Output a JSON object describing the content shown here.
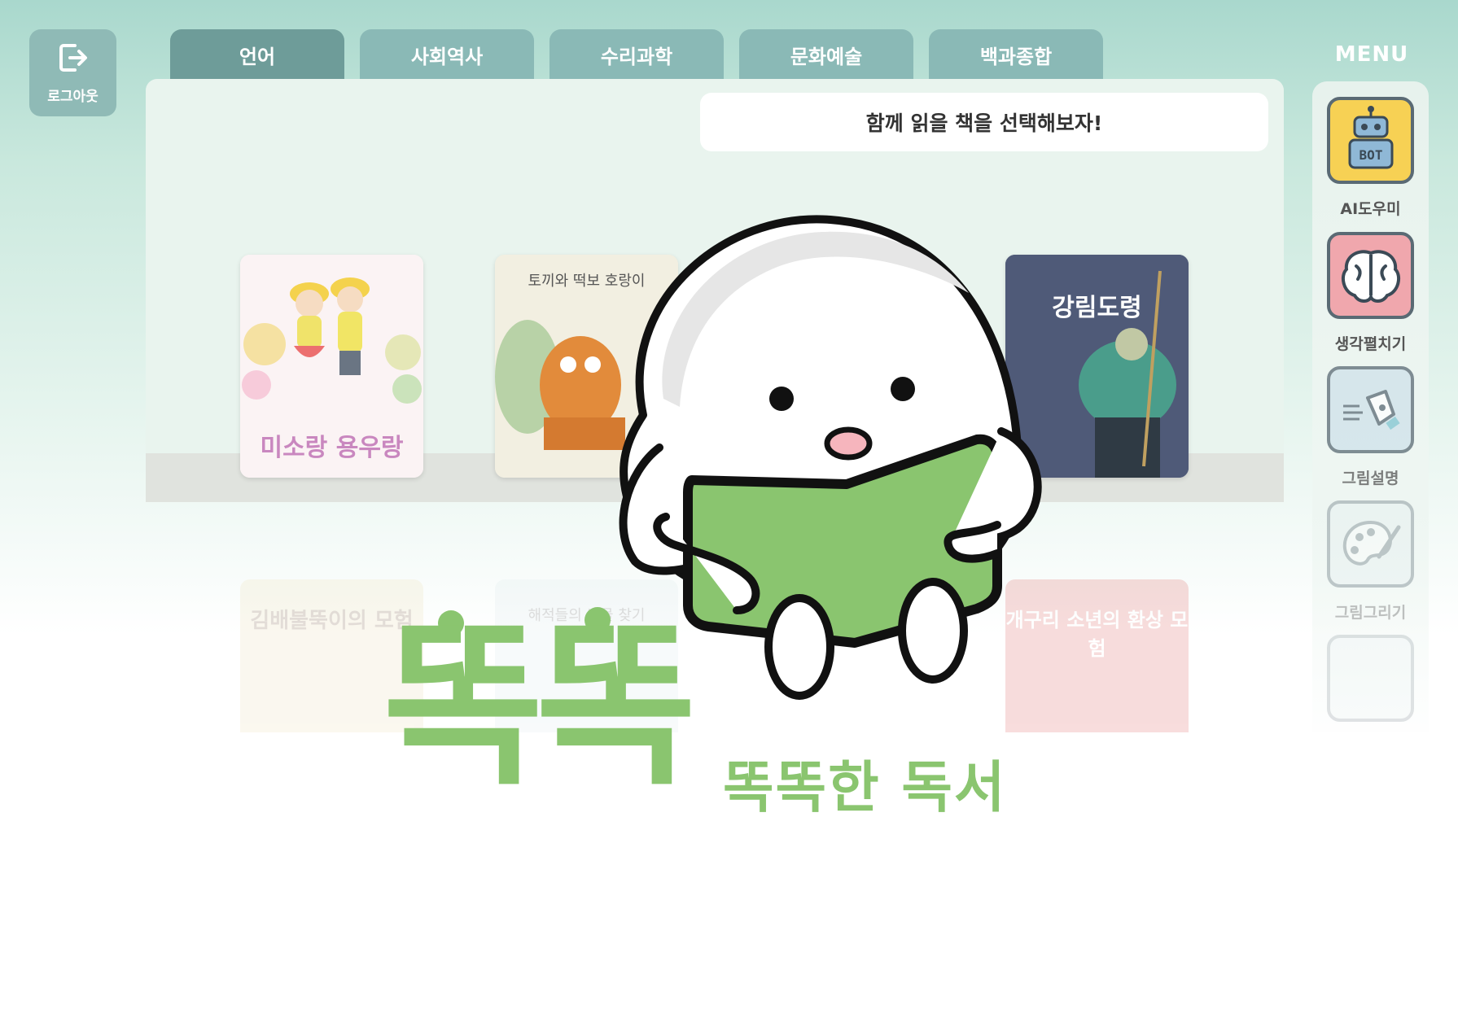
{
  "logout": {
    "label": "로그아웃",
    "icon": "logout-icon"
  },
  "tabs": [
    {
      "label": "언어",
      "active": true
    },
    {
      "label": "사회역사",
      "active": false
    },
    {
      "label": "수리과학",
      "active": false
    },
    {
      "label": "문화예술",
      "active": false
    },
    {
      "label": "백과종합",
      "active": false
    }
  ],
  "menu": {
    "title": "MENU",
    "items": [
      {
        "label": "AI도우미",
        "icon": "robot-bot-icon"
      },
      {
        "label": "생각펼치기",
        "icon": "brain-icon"
      },
      {
        "label": "그림설명",
        "icon": "pen-nib-icon"
      },
      {
        "label": "그림그리기",
        "icon": "palette-icon"
      }
    ]
  },
  "banner": {
    "text": "함께 읽을 책을 선택해보자!"
  },
  "books": [
    {
      "title": "미소랑 용우랑",
      "color": "#f4c6d8"
    },
    {
      "title": "토끼와 떡보 호랑이",
      "color": "#f2efe1"
    },
    {
      "title": "강림도령",
      "color": "#4c5877"
    }
  ],
  "reflection_books": [
    {
      "title": "김배불뚝이의 모험"
    },
    {
      "title": "해적들의 보물 찾기"
    },
    {
      "title": "개구리 소년의 환상 모험"
    }
  ],
  "splash": {
    "logo": "똑똑",
    "tagline": "똑똑한 독서",
    "brand_color": "#8ac56f"
  },
  "colors": {
    "tab": "#8ab9b6",
    "tab_active": "#6e9c99",
    "panel": "#e9f4ee"
  }
}
